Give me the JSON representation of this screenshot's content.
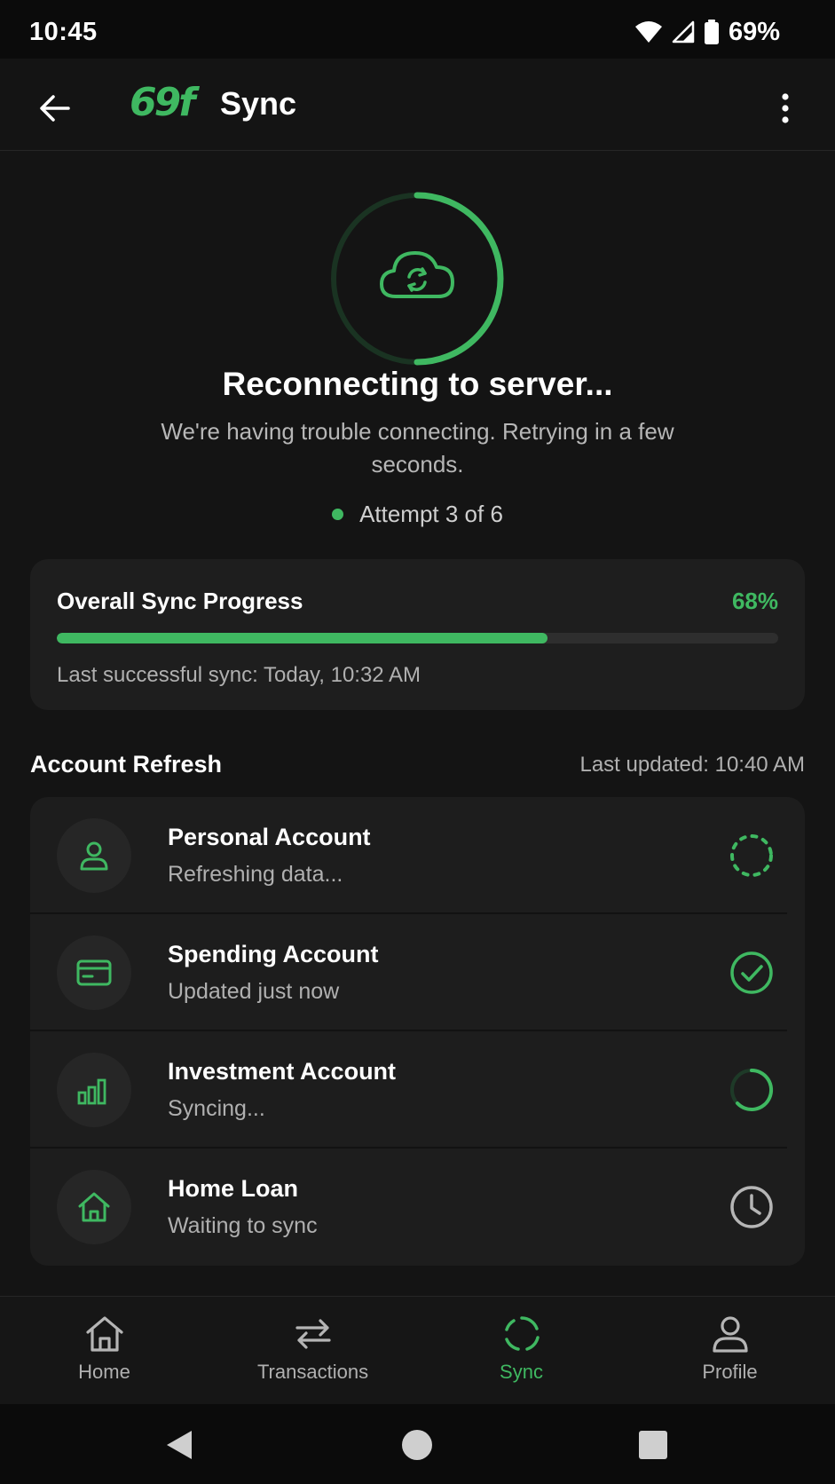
{
  "status_bar": {
    "time": "10:45",
    "battery_percent": "69%",
    "icons": [
      "wifi-icon",
      "cell-signal-icon",
      "battery-icon"
    ]
  },
  "app_bar": {
    "logo_text": "69f",
    "title": "Sync",
    "back_icon": "arrow-left-icon",
    "menu_icon": "more-vertical-icon"
  },
  "sync_status": {
    "icon": "cloud-sync-icon",
    "title": "Reconnecting to server...",
    "message": "We're having trouble connecting. Retrying in a few seconds.",
    "attempt": "Attempt 3 of 6",
    "ring_progress_fraction": 0.5
  },
  "overall_progress": {
    "title": "Overall Sync Progress",
    "percent_label": "68%",
    "percent_value": 68,
    "last_sync": "Last successful sync: Today, 10:32 AM"
  },
  "account_refresh": {
    "title": "Account Refresh",
    "last_updated": "Last updated: 10:40 AM",
    "accounts": [
      {
        "name": "Personal Account",
        "status": "Refreshing data...",
        "icon": "user-icon",
        "state": "refreshing"
      },
      {
        "name": "Spending Account",
        "status": "Updated just now",
        "icon": "credit-card-icon",
        "state": "done"
      },
      {
        "name": "Investment Account",
        "status": "Syncing...",
        "icon": "bar-chart-icon",
        "state": "syncing"
      },
      {
        "name": "Home Loan",
        "status": "Waiting to sync",
        "icon": "home-icon",
        "state": "waiting"
      }
    ]
  },
  "bottom_nav": {
    "items": [
      {
        "label": "Home",
        "icon": "home-icon",
        "active": false
      },
      {
        "label": "Transactions",
        "icon": "swap-arrows-icon",
        "active": false
      },
      {
        "label": "Sync",
        "icon": "sync-icon",
        "active": true
      },
      {
        "label": "Profile",
        "icon": "user-icon",
        "active": false
      }
    ]
  },
  "colors": {
    "accent": "#3fb861",
    "background": "#141414",
    "card": "#1e1e1e",
    "text_primary": "#ffffff",
    "text_secondary": "#b0b0b0"
  }
}
